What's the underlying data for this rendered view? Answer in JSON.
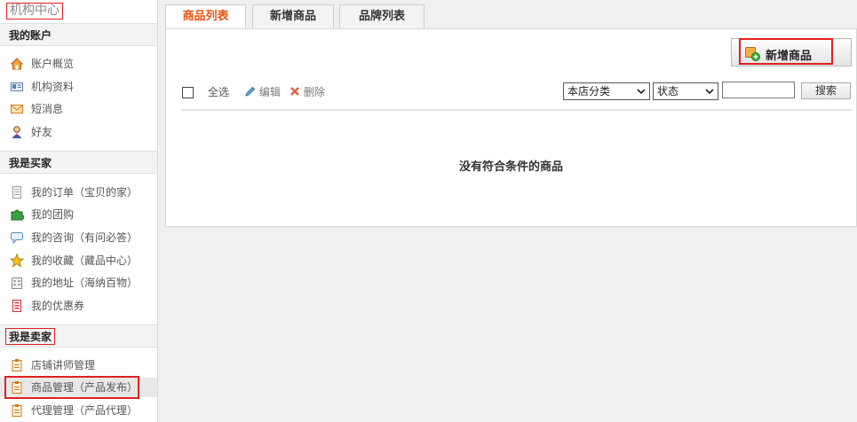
{
  "sidebar": {
    "title": "机构中心",
    "account": {
      "header": "我的账户",
      "items": [
        {
          "label": "账户概览",
          "icon": "house-icon"
        },
        {
          "label": "机构资料",
          "icon": "id-card-icon"
        },
        {
          "label": "短消息",
          "icon": "envelope-icon"
        },
        {
          "label": "好友",
          "icon": "friend-icon"
        }
      ]
    },
    "buyer": {
      "header": "我是买家",
      "items": [
        {
          "label": "我的订单（宝贝的家）",
          "icon": "order-icon"
        },
        {
          "label": "我的团购",
          "icon": "puzzle-icon"
        },
        {
          "label": "我的咨询（有问必答）",
          "icon": "speech-icon"
        },
        {
          "label": "我的收藏（藏品中心）",
          "icon": "star-icon"
        },
        {
          "label": "我的地址（海纳百物）",
          "icon": "address-icon"
        },
        {
          "label": "我的优惠券",
          "icon": "coupon-icon"
        }
      ]
    },
    "seller": {
      "header": "我是卖家",
      "items": [
        {
          "label": "店铺讲师管理",
          "icon": "clipboard-icon"
        },
        {
          "label": "商品管理（产品发布）",
          "icon": "clipboard-icon"
        },
        {
          "label": "代理管理（产品代理）",
          "icon": "clipboard-icon"
        }
      ]
    }
  },
  "tabs": [
    "商品列表",
    "新增商品",
    "品牌列表"
  ],
  "toolbar": {
    "add_button": "新增商品",
    "select_all": "全选",
    "edit": "编辑",
    "delete": "删除",
    "category_select": "本店分类",
    "status_select": "状态",
    "search_value": "",
    "search_button": "搜索"
  },
  "empty_message": "没有符合条件的商品",
  "colors": {
    "accent": "#ea5413",
    "highlight_box": "#e02020"
  }
}
